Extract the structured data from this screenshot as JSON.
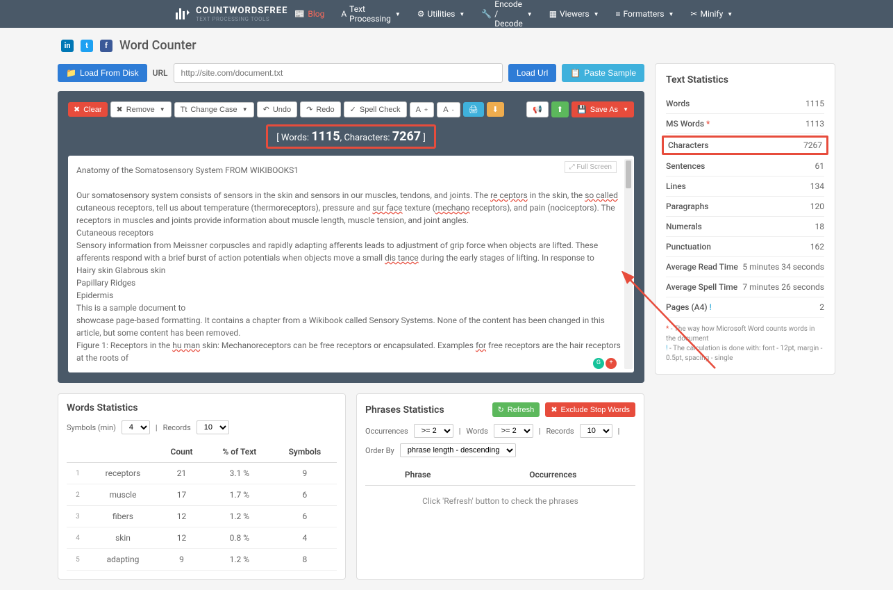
{
  "brand": {
    "name": "COUNTWORDSFREE",
    "sub": "TEXT PROCESSING TOOLS"
  },
  "nav": {
    "blog": "Blog",
    "text_processing": "Text Processing",
    "utilities": "Utilities",
    "encode_decode": "Encode / Decode",
    "viewers": "Viewers",
    "formatters": "Formatters",
    "minify": "Minify"
  },
  "page_title": "Word Counter",
  "url_bar": {
    "load_disk": "Load From Disk",
    "url_label": "URL",
    "url_placeholder": "http://site.com/document.txt",
    "load_url": "Load Url",
    "paste_sample": "Paste Sample"
  },
  "toolbar": {
    "clear": "Clear",
    "remove": "Remove",
    "change_case": "Change Case",
    "undo": "Undo",
    "redo": "Redo",
    "spell_check": "Spell Check",
    "save_as": "Save As"
  },
  "counter": {
    "words_label": "Words:",
    "words": "1115",
    "chars_label": "Characters:",
    "chars": "7267"
  },
  "editor": {
    "fullscreen": "Full Screen",
    "line1": "Anatomy of the Somatosensory System FROM WIKIBOOKS1",
    "line2a": "Our somatosensory system consists of sensors in the skin and sensors in our muscles, tendons, and joints. The ",
    "line2b": "re ceptors",
    "line2c": " in the skin, the ",
    "line2d": "so called",
    "line2e": " cutaneous receptors, tell us about temperature (thermoreceptors), pressure and ",
    "line2f": "sur face",
    "line2g": " texture (",
    "line2h": "mechano",
    "line2i": " receptors), and pain (nociceptors). The receptors in muscles and joints provide information about muscle length, muscle tension, and joint angles.",
    "line3": "Cutaneous receptors",
    "line4a": "Sensory information from Meissner corpuscles and rapidly adapting afferents leads to adjustment of grip force when objects are lifted. These afferents respond with a brief burst of action potentials when objects move a small ",
    "line4b": "dis tance",
    "line4c": " during the early stages of lifting. In response to",
    "line5": "Hairy skin Glabrous skin",
    "line6": "Papillary Ridges",
    "line7": "Epidermis",
    "line8": "This is a sample document to",
    "line9": "showcase page-based formatting. It contains a chapter from a Wikibook called Sensory Systems. None of the content has been changed in this",
    "line10": "article, but some content has been removed.",
    "line11a": "Figure 1: Receptors in the ",
    "line11b": "hu man",
    "line11c": " skin: Mechanoreceptors can be free receptors or encapsulated. Examples ",
    "line11d": "for",
    "line11e": " free receptors are the hair receptors at the roots of"
  },
  "words_stats": {
    "title": "Words Statistics",
    "symbols_min": "Symbols (min)",
    "symbols_val": "4",
    "records": "Records",
    "records_val": "10",
    "headers": {
      "word": "",
      "count": "Count",
      "pct": "% of Text",
      "symbols": "Symbols"
    },
    "rows": [
      {
        "i": "1",
        "word": "receptors",
        "count": "21",
        "pct": "3.1 %",
        "sym": "9"
      },
      {
        "i": "2",
        "word": "muscle",
        "count": "17",
        "pct": "1.7 %",
        "sym": "6"
      },
      {
        "i": "3",
        "word": "fibers",
        "count": "12",
        "pct": "1.2 %",
        "sym": "6"
      },
      {
        "i": "4",
        "word": "skin",
        "count": "12",
        "pct": "0.8 %",
        "sym": "4"
      },
      {
        "i": "5",
        "word": "adapting",
        "count": "9",
        "pct": "1.2 %",
        "sym": "8"
      }
    ]
  },
  "phrases_stats": {
    "title": "Phrases Statistics",
    "refresh": "Refresh",
    "exclude": "Exclude Stop Words",
    "occurrences": "Occurrences",
    "occ_val": ">= 2",
    "words": "Words",
    "words_val": ">= 2",
    "records": "Records",
    "records_val": "10",
    "order_by": "Order By",
    "order_val": "phrase length - descending",
    "th_phrase": "Phrase",
    "th_occ": "Occurrences",
    "placeholder": "Click 'Refresh' button to check the phrases"
  },
  "text_stats": {
    "title": "Text Statistics",
    "rows": [
      {
        "label": "Words",
        "value": "1115",
        "highlight": false
      },
      {
        "label": "MS Words",
        "suffix": "*",
        "value": "1113",
        "highlight": false
      },
      {
        "label": "Characters",
        "value": "7267",
        "highlight": true
      },
      {
        "label": "Sentences",
        "value": "61",
        "highlight": false
      },
      {
        "label": "Lines",
        "value": "134",
        "highlight": false
      },
      {
        "label": "Paragraphs",
        "value": "120",
        "highlight": false
      },
      {
        "label": "Numerals",
        "value": "18",
        "highlight": false
      },
      {
        "label": "Punctuation",
        "value": "162",
        "highlight": false
      },
      {
        "label": "Average Read Time",
        "value": "5 minutes 34 seconds",
        "highlight": false
      },
      {
        "label": "Average Spell Time",
        "value": "7 minutes 26 seconds",
        "highlight": false
      },
      {
        "label": "Pages (A4)",
        "suffix": "!",
        "value": "2",
        "highlight": false
      }
    ],
    "footnote1": " - The way how Microsoft Word counts words in the document",
    "footnote2": " - The calculation is done with: font - 12pt, margin - 0.5pt, spacing - single"
  }
}
